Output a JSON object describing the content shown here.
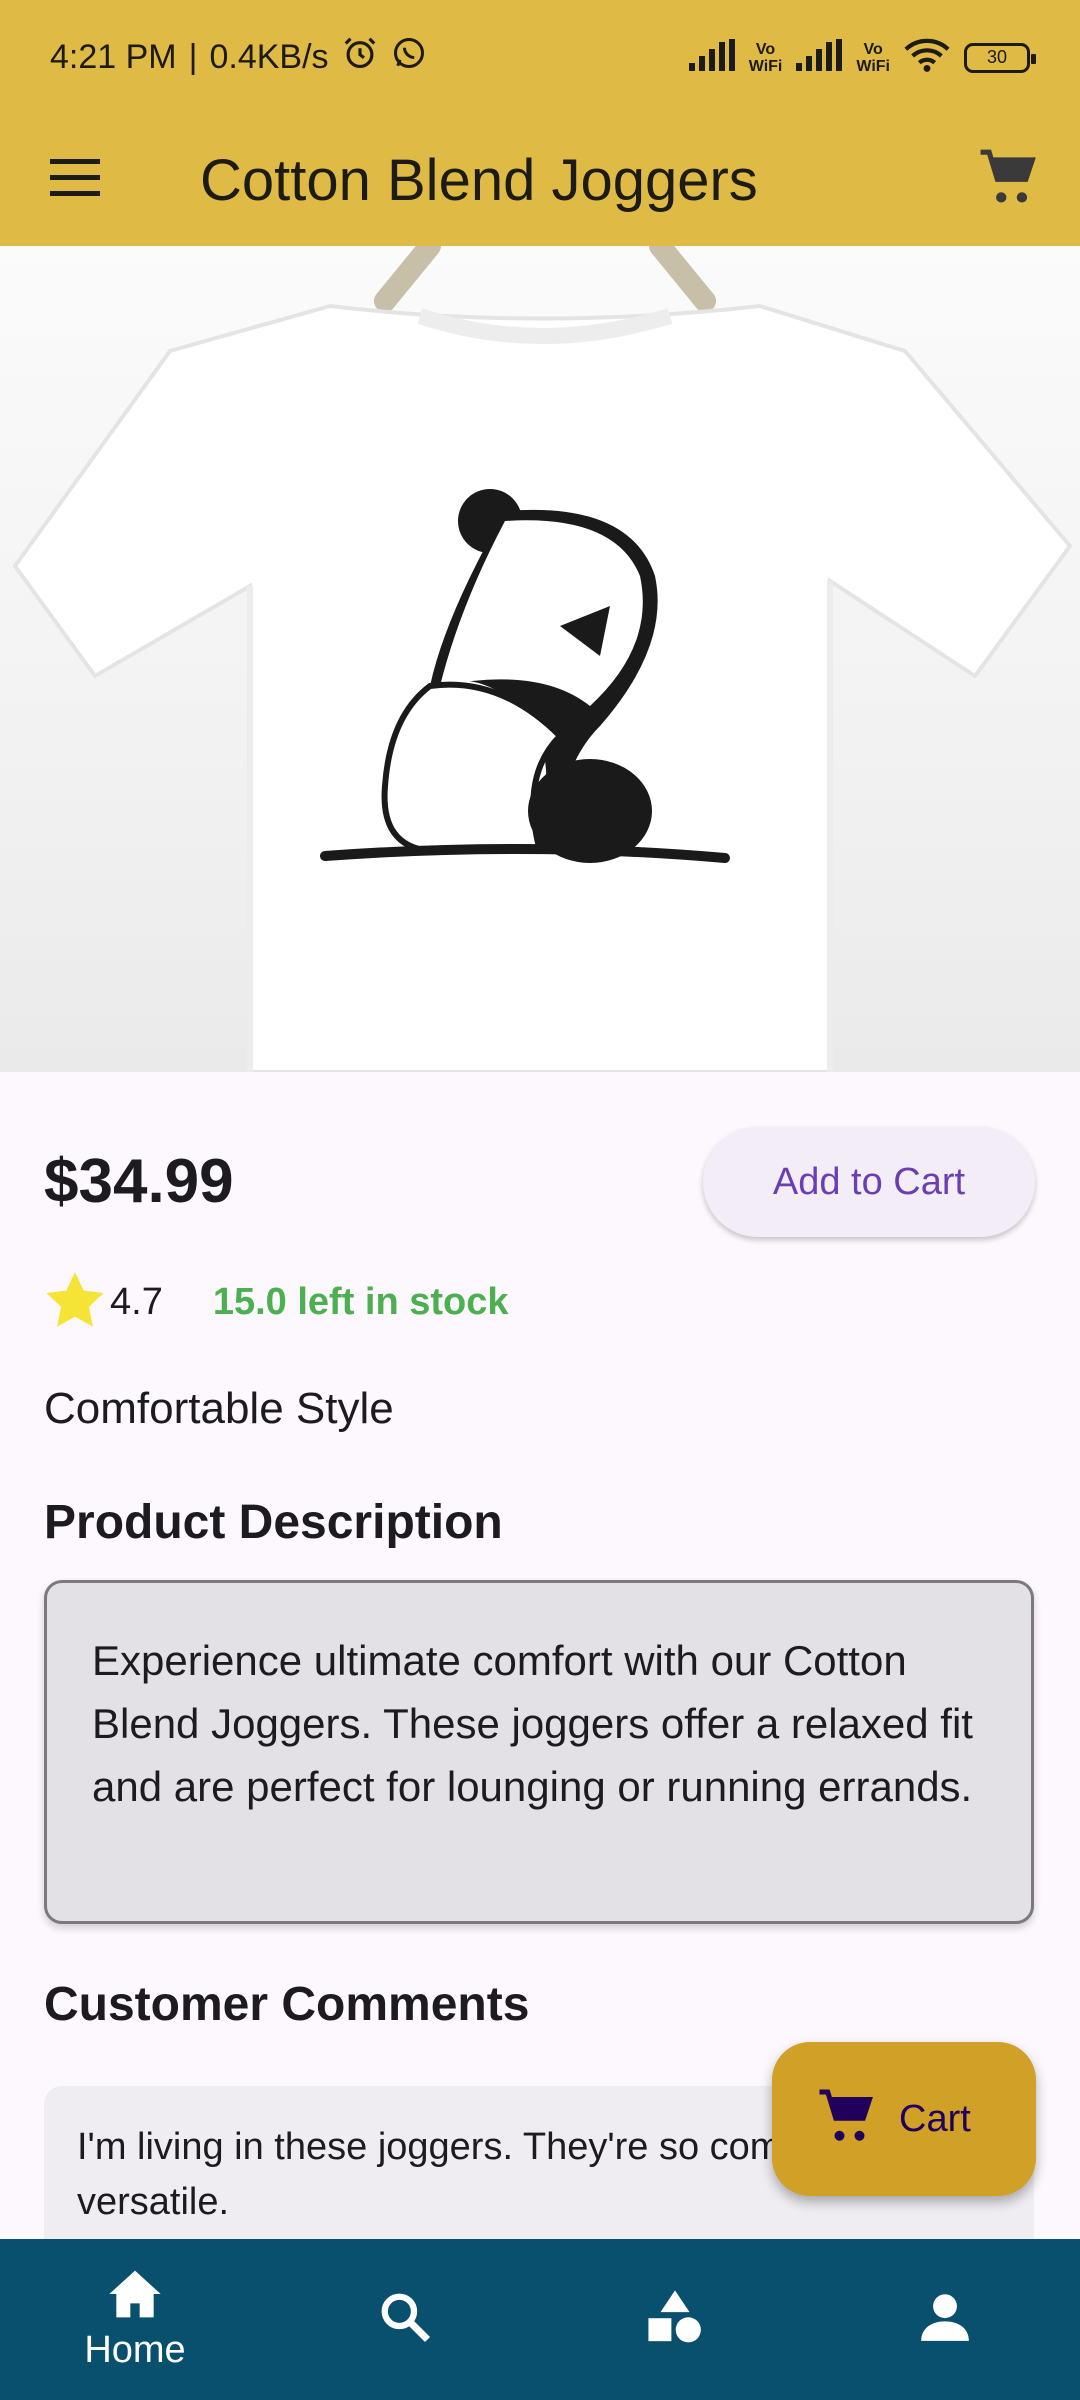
{
  "status_bar": {
    "time": "4:21 PM",
    "speed": "0.4KB/s",
    "sim1_label_top": "Vo",
    "sim1_label_bottom": "WiFi",
    "sim2_label_top": "Vo",
    "sim2_label_bottom": "WiFi",
    "battery": "30",
    "icons": [
      "alarm-icon",
      "whatsapp-icon",
      "signal-icon",
      "wifi-icon",
      "battery-icon"
    ]
  },
  "app_bar": {
    "title": "Cotton Blend Joggers",
    "menu_icon": "menu-icon",
    "cart_icon": "cart-icon"
  },
  "product": {
    "image_icon": "product-image",
    "price": "$34.99",
    "add_to_cart_label": "Add to Cart",
    "rating": "4.7",
    "stock": "15.0 left in stock",
    "subtitle": "Comfortable Style"
  },
  "description": {
    "heading": "Product Description",
    "text": "Experience ultimate comfort with our Cotton Blend Joggers. These joggers offer a relaxed fit and are perfect for lounging or running errands."
  },
  "comments": {
    "heading": "Customer Comments",
    "items": [
      "I'm living in these joggers. They're so comfortable and versatile."
    ]
  },
  "fab": {
    "label": "Cart"
  },
  "bottom_nav": {
    "items": [
      {
        "label": "Home",
        "icon": "home-icon"
      },
      {
        "label": "",
        "icon": "search-icon"
      },
      {
        "label": "",
        "icon": "categories-icon"
      },
      {
        "label": "",
        "icon": "profile-icon"
      }
    ]
  },
  "colors": {
    "app_bar": "#dfba45",
    "accent": "#6a3fb2",
    "stock_green": "#4caf50",
    "fab": "#d0a126",
    "bottom_nav": "#08506e",
    "star": "#f5e335"
  }
}
